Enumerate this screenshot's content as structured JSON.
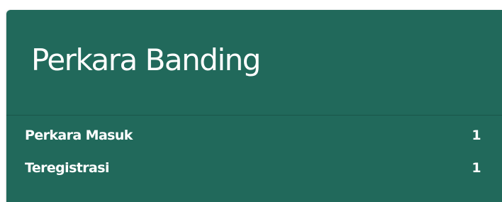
{
  "card": {
    "title": "Perkara Banding",
    "rows": [
      {
        "label": "Perkara Masuk",
        "value": "1"
      },
      {
        "label": "Teregistrasi",
        "value": "1"
      }
    ]
  },
  "colors": {
    "card_background": "#21695b",
    "divider": "#1a5649",
    "text": "#ffffff"
  }
}
